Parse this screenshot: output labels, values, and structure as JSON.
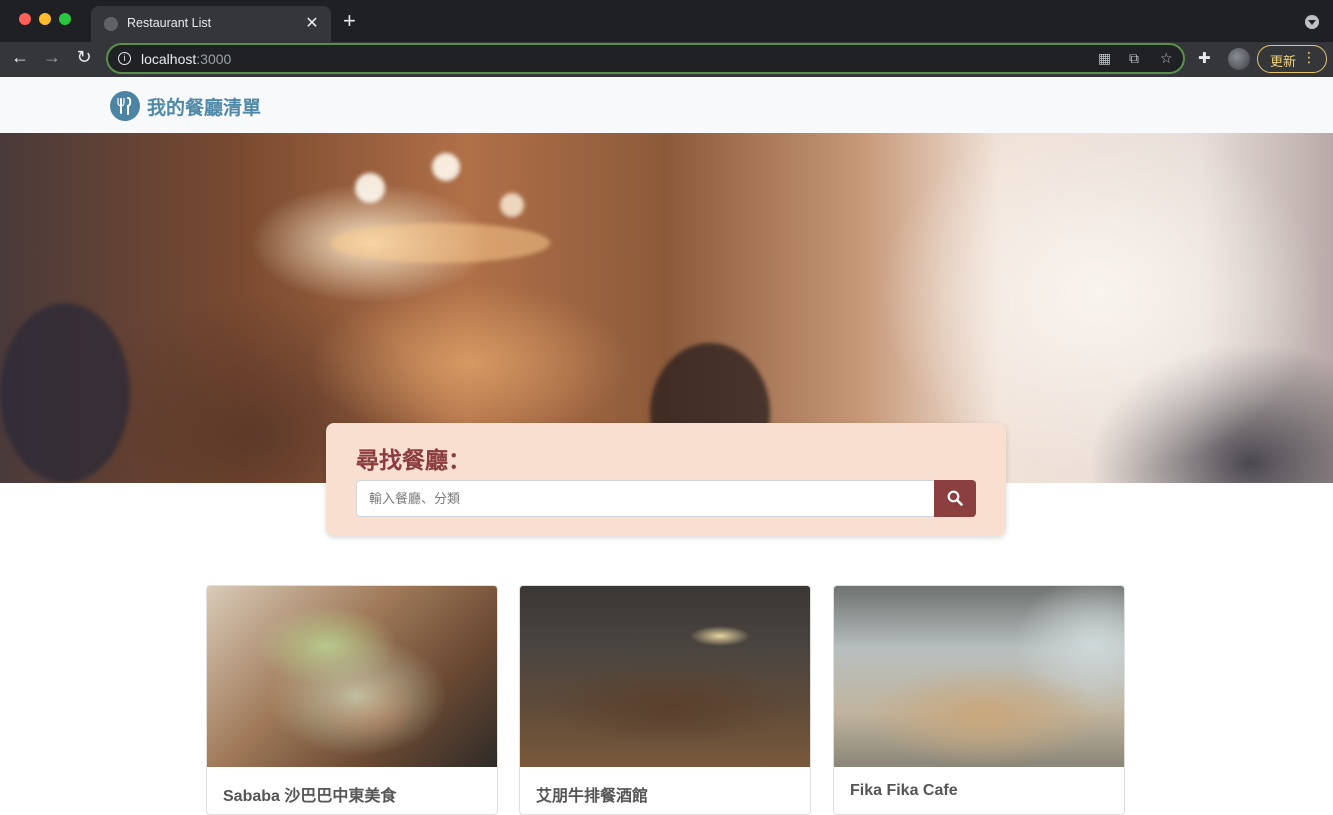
{
  "browser": {
    "tab_title": "Restaurant List",
    "tab_close": "✕",
    "new_tab": "+",
    "url_host": "localhost",
    "url_port": ":3000",
    "update_label": "更新",
    "update_menu": "⋮"
  },
  "navbar": {
    "brand": "我的餐廳清單"
  },
  "search": {
    "title": "尋找餐廳：",
    "placeholder": "輸入餐廳、分類"
  },
  "restaurants": [
    {
      "name": "Sababa 沙巴巴中東美食"
    },
    {
      "name": "艾朋牛排餐酒館"
    },
    {
      "name": "Fika Fika Cafe"
    }
  ]
}
